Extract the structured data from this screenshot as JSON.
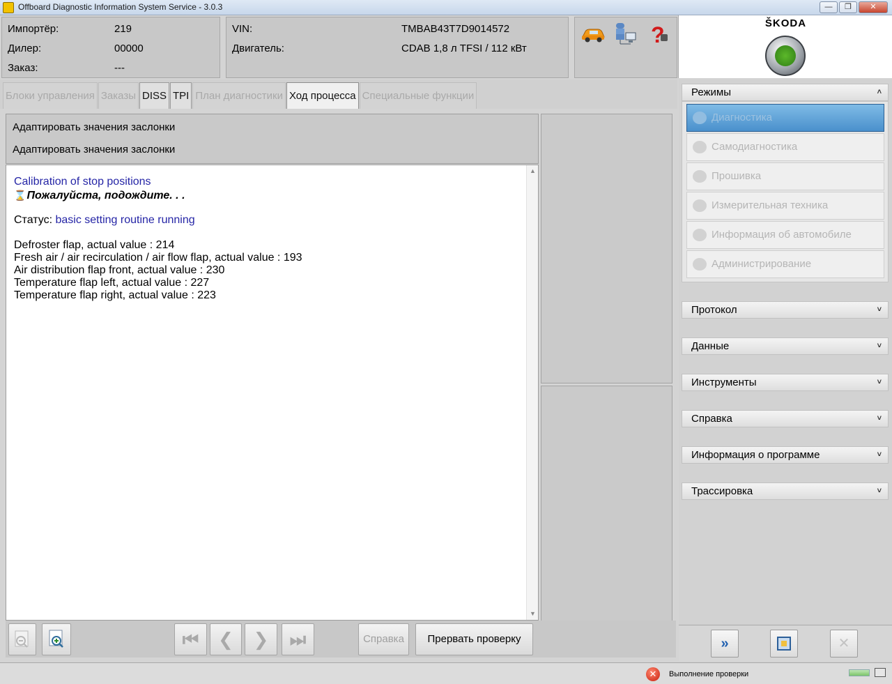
{
  "window": {
    "title": "Offboard Diagnostic Information System Service - 3.0.3",
    "buttons": [
      "—",
      "❐",
      "✕"
    ]
  },
  "header": {
    "importer_label": "Импортёр:",
    "importer_value": "219",
    "dealer_label": "Дилер:",
    "dealer_value": "00000",
    "order_label": "Заказ:",
    "order_value": "---",
    "vin_label": "VIN:",
    "vin_value": "TMBAB43T7D9014572",
    "engine_label": "Двигатель:",
    "engine_value": "CDAB 1,8 л TFSI / 112 кВт",
    "icons": [
      "car-icon",
      "network-icon",
      "help-icon"
    ]
  },
  "brand": {
    "name": "ŠKODA",
    "logo": "skoda-emblem-icon"
  },
  "tabs": [
    {
      "label": "Блоки управления",
      "state": "disabled"
    },
    {
      "label": "Заказы",
      "state": "disabled"
    },
    {
      "label": "DISS",
      "state": "enabled"
    },
    {
      "label": "TPI",
      "state": "enabled"
    },
    {
      "label": "План диагностики",
      "state": "disabled"
    },
    {
      "label": "Ход процесса",
      "state": "active"
    },
    {
      "label": "Специальные функции",
      "state": "disabled"
    }
  ],
  "procedure": {
    "title1": "Адаптировать значения заслонки",
    "title2": "Адаптировать значения заслонки",
    "heading": "Calibration of stop positions",
    "wait_text": "Пожалуйста, подождите. . .",
    "status_label": "Статус:",
    "status_value": "basic setting routine running",
    "values": [
      "Defroster flap, actual value  : 214",
      "Fresh air / air recirculation / air flow flap, actual value  : 193",
      "Air distribution flap front, actual value  : 230",
      "Temperature flap left, actual value  : 227",
      "Temperature flap right, actual value  : 223"
    ]
  },
  "toolbar": {
    "zoom_out": "zoom-out-icon",
    "zoom_in": "zoom-in-icon",
    "first": "⏮",
    "prev": "❮",
    "next": "❯",
    "last": "⏭",
    "help_label": "Справка",
    "abort_label": "Прервать проверку"
  },
  "sidebar": {
    "modes_title": "Режимы",
    "modes": [
      {
        "label": "Диагностика",
        "icon": "stethoscope-icon",
        "selected": true
      },
      {
        "label": "Самодиагностика",
        "icon": "hand-icon",
        "selected": false
      },
      {
        "label": "Прошивка",
        "icon": "chip-icon",
        "selected": false
      },
      {
        "label": "Измерительная техника",
        "icon": "gauge-icon",
        "selected": false
      },
      {
        "label": "Информация об автомобиле",
        "icon": "car-info-icon",
        "selected": false
      },
      {
        "label": "Администрирование",
        "icon": "gear-icon",
        "selected": false
      }
    ],
    "sections": [
      "Протокол",
      "Данные",
      "Инструменты",
      "Справка",
      "Информация о программе",
      "Трассировка"
    ]
  },
  "statusbar": {
    "text": "Выполнение проверки"
  },
  "colors": {
    "accent_blue": "#4a90cc",
    "link_blue": "#2525a6",
    "skoda_green": "#4aa52a",
    "error_red": "#c81d0b"
  }
}
